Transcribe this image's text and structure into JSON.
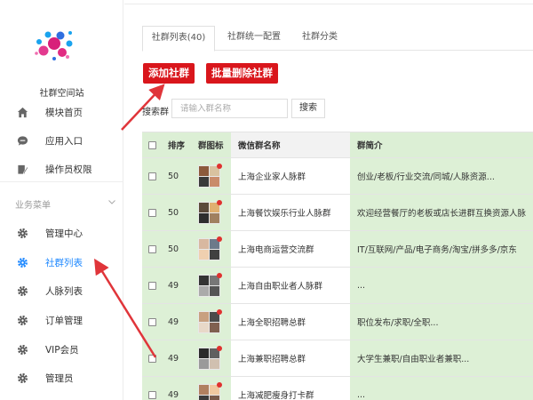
{
  "sidebar": {
    "site_name": "社群空间站",
    "items": [
      {
        "label": "模块首页",
        "icon": "home-icon"
      },
      {
        "label": "应用入口",
        "icon": "chat-icon"
      },
      {
        "label": "操作员权限",
        "icon": "edit-icon"
      }
    ],
    "section_label": "业务菜单",
    "section_items": [
      {
        "label": "管理中心",
        "icon": "gear-icon"
      },
      {
        "label": "社群列表",
        "icon": "gear-icon",
        "active": true
      },
      {
        "label": "人脉列表",
        "icon": "gear-icon"
      },
      {
        "label": "订单管理",
        "icon": "gear-icon"
      },
      {
        "label": "VIP会员",
        "icon": "gear-icon"
      },
      {
        "label": "管理员",
        "icon": "gear-icon"
      }
    ],
    "active_color": "#1e88ff"
  },
  "tabs": [
    {
      "label": "社群列表(40)",
      "active": true
    },
    {
      "label": "社群统一配置"
    },
    {
      "label": "社群分类"
    }
  ],
  "actions": {
    "add_label": "添加社群",
    "batch_delete_label": "批量删除社群",
    "color": "#d9161c"
  },
  "search": {
    "label": "搜索群",
    "placeholder": "请输入群名称",
    "button": "搜索"
  },
  "table": {
    "headers": {
      "sort": "排序",
      "icon": "群图标",
      "name": "微信群名称",
      "desc": "群简介"
    },
    "rows": [
      {
        "sort": "50",
        "name": "上海企业家人脉群",
        "desc": "创业/老板/行业交流/同城/人脉资源..."
      },
      {
        "sort": "50",
        "name": "上海餐饮娱乐行业人脉群",
        "desc": "欢迎经营餐厅的老板或店长进群互换资源人脉"
      },
      {
        "sort": "50",
        "name": "上海电商运营交流群",
        "desc": "IT/互联网/产品/电子商务/淘宝/拼多多/京东"
      },
      {
        "sort": "49",
        "name": "上海自由职业者人脉群",
        "desc": "..."
      },
      {
        "sort": "49",
        "name": "上海全职招聘总群",
        "desc": "职位发布/求职/全职..."
      },
      {
        "sort": "49",
        "name": "上海兼职招聘总群",
        "desc": "大学生兼职/自由职业者兼职..."
      },
      {
        "sort": "49",
        "name": "上海减肥瘦身打卡群",
        "desc": "..."
      }
    ],
    "highlight_color": "#ddf0d6"
  }
}
